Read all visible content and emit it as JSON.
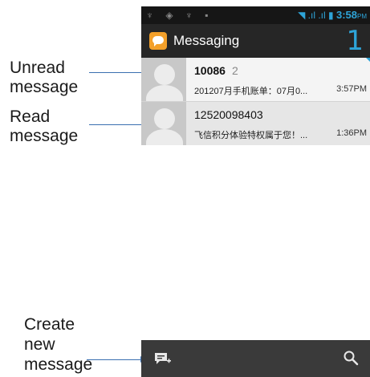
{
  "annotations": {
    "unread": [
      "Unread",
      "message"
    ],
    "read": [
      "Read",
      "message"
    ],
    "create": [
      "Create",
      "new",
      "message"
    ]
  },
  "status_bar": {
    "left_icons": "♆ ◈ ♆ ▪",
    "right_icons": "◥ .ıl .ıl ▮",
    "time": "3:58",
    "ampm": "PM"
  },
  "action_bar": {
    "title": "Messaging",
    "unread_count": "1",
    "icon": "messaging-app-icon"
  },
  "messages": [
    {
      "sender": "10086",
      "count": "2",
      "snippet": "201207月手机账单：07月0...",
      "time": "3:57PM",
      "status": "unread"
    },
    {
      "sender": "12520098403",
      "count": "",
      "snippet": "飞信积分体验特权属于您！...",
      "time": "1:36PM",
      "status": "read"
    }
  ],
  "bottom_bar": {
    "left_icon": "compose-message-icon",
    "right_icon": "search-icon"
  },
  "colors": {
    "accent": "#2ea4d8",
    "arrow": "#3a6fb0",
    "actionbar": "#262626",
    "bottombar": "#3a3a3a"
  }
}
